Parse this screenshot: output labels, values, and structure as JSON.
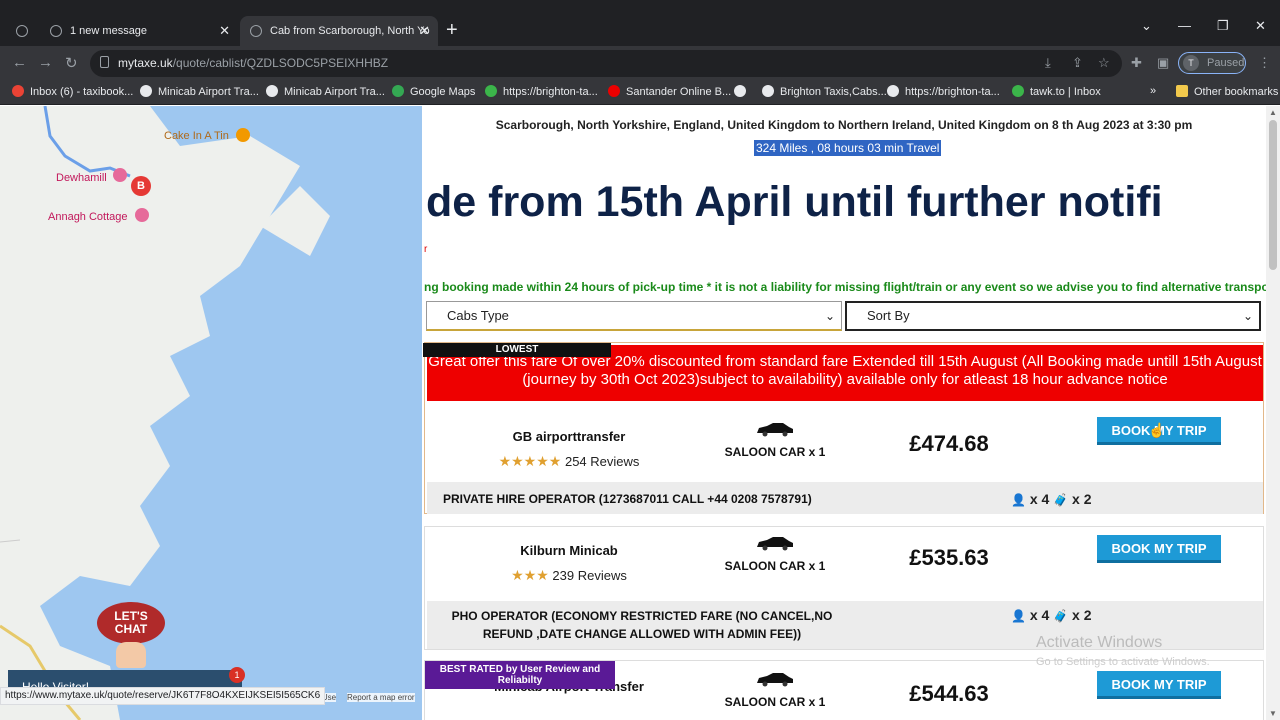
{
  "browser": {
    "tabs": [
      {
        "title": "1 new message",
        "close": "✕"
      },
      {
        "title": "Cab from Scarborough, North Yo",
        "close": "✕"
      }
    ],
    "new_tab": "+",
    "url_domain": "mytaxe.uk",
    "url_path": "/quote/cablist/QZDLSODC5PSEIXHHBZ",
    "profile_initial": "T",
    "profile_status": "Paused",
    "bookmarks": [
      "Inbox (6) - taxibook...",
      "Minicab Airport Tra...",
      "Minicab Airport Tra...",
      "Google Maps",
      "https://brighton-ta...",
      "Santander Online B...",
      "Brighton Taxis,Cabs...",
      "https://brighton-ta...",
      "tawk.to | Inbox"
    ],
    "bookmarks_overflow": "»",
    "other_bookmarks": "Other bookmarks",
    "status_url": "https://www.mytaxe.uk/quote/reserve/JK6T7F8O4KXEIJKSEI5I565CK6"
  },
  "map": {
    "labels": {
      "cake": "Cake In A Tin",
      "dewhamill": "Dewhamill",
      "annagh": "Annagh Cottage",
      "marker": "B"
    },
    "chat_badge": "LET'S CHAT",
    "hello": "Hello Visitor!",
    "notif_count": "1",
    "footer_terms": "of Use",
    "footer_report": "Report a map error"
  },
  "quote": {
    "route": "Scarborough, North Yorkshire, England, United Kingdom to Northern Ireland, United Kingdom on 8 th Aug 2023 at 3:30 pm",
    "distance": "324 Miles , 08 hours 03 min Travel",
    "marquee_big": "de from 15th April until further notifi",
    "red_mark": "r",
    "marquee_small": "ng booking made within 24 hours of pick-up time * it is not a liability for missing flight/train or any event so we advise you to find alternative transport a",
    "cabs_type": "Cabs Type",
    "sort_by": "Sort By"
  },
  "cabs": [
    {
      "ribbon": "LOWEST",
      "promo": "Great offer this fare Of over 20% discounted from standard fare Extended till 15th August (All Booking made untill 15th August (journey by 30th Oct 2023)subject to availability) available only for atleast 18 hour advance notice",
      "operator": "GB airporttransfer",
      "stars": "★★★★★",
      "reviews": "254 Reviews",
      "car_type": "SALOON CAR x 1",
      "price": "£474.68",
      "book": "BOOK MY TRIP",
      "info": "PRIVATE HIRE OPERATOR (1273687011 CALL +44 0208 7578791)",
      "passengers": "x 4",
      "luggage": "x 2"
    },
    {
      "operator": "Kilburn Minicab",
      "stars": "★★★",
      "reviews": "239 Reviews",
      "car_type": "SALOON CAR x 1",
      "price": "£535.63",
      "book": "BOOK MY TRIP",
      "info": "PHO OPERATOR (ECONOMY RESTRICTED FARE (NO CANCEL,NO REFUND ,DATE CHANGE ALLOWED WITH ADMIN FEE))",
      "passengers": "x 4",
      "luggage": "x 2"
    },
    {
      "ribbon": "BEST RATED by User Review and Reliabilty",
      "operator": "Minicab Airport Transfer",
      "car_type": "SALOON CAR x 1",
      "price": "£544.63",
      "book": "BOOK MY TRIP"
    }
  ],
  "watermark": {
    "title": "Activate Windows",
    "subtitle": "Go to Settings to activate Windows."
  },
  "colors": {
    "accent": "#1e9ad6",
    "promo_red": "#e00000",
    "marquee_navy": "#0e2247",
    "notice_green": "#1a8a1a",
    "best_rated_purple": "#5a1a96"
  }
}
